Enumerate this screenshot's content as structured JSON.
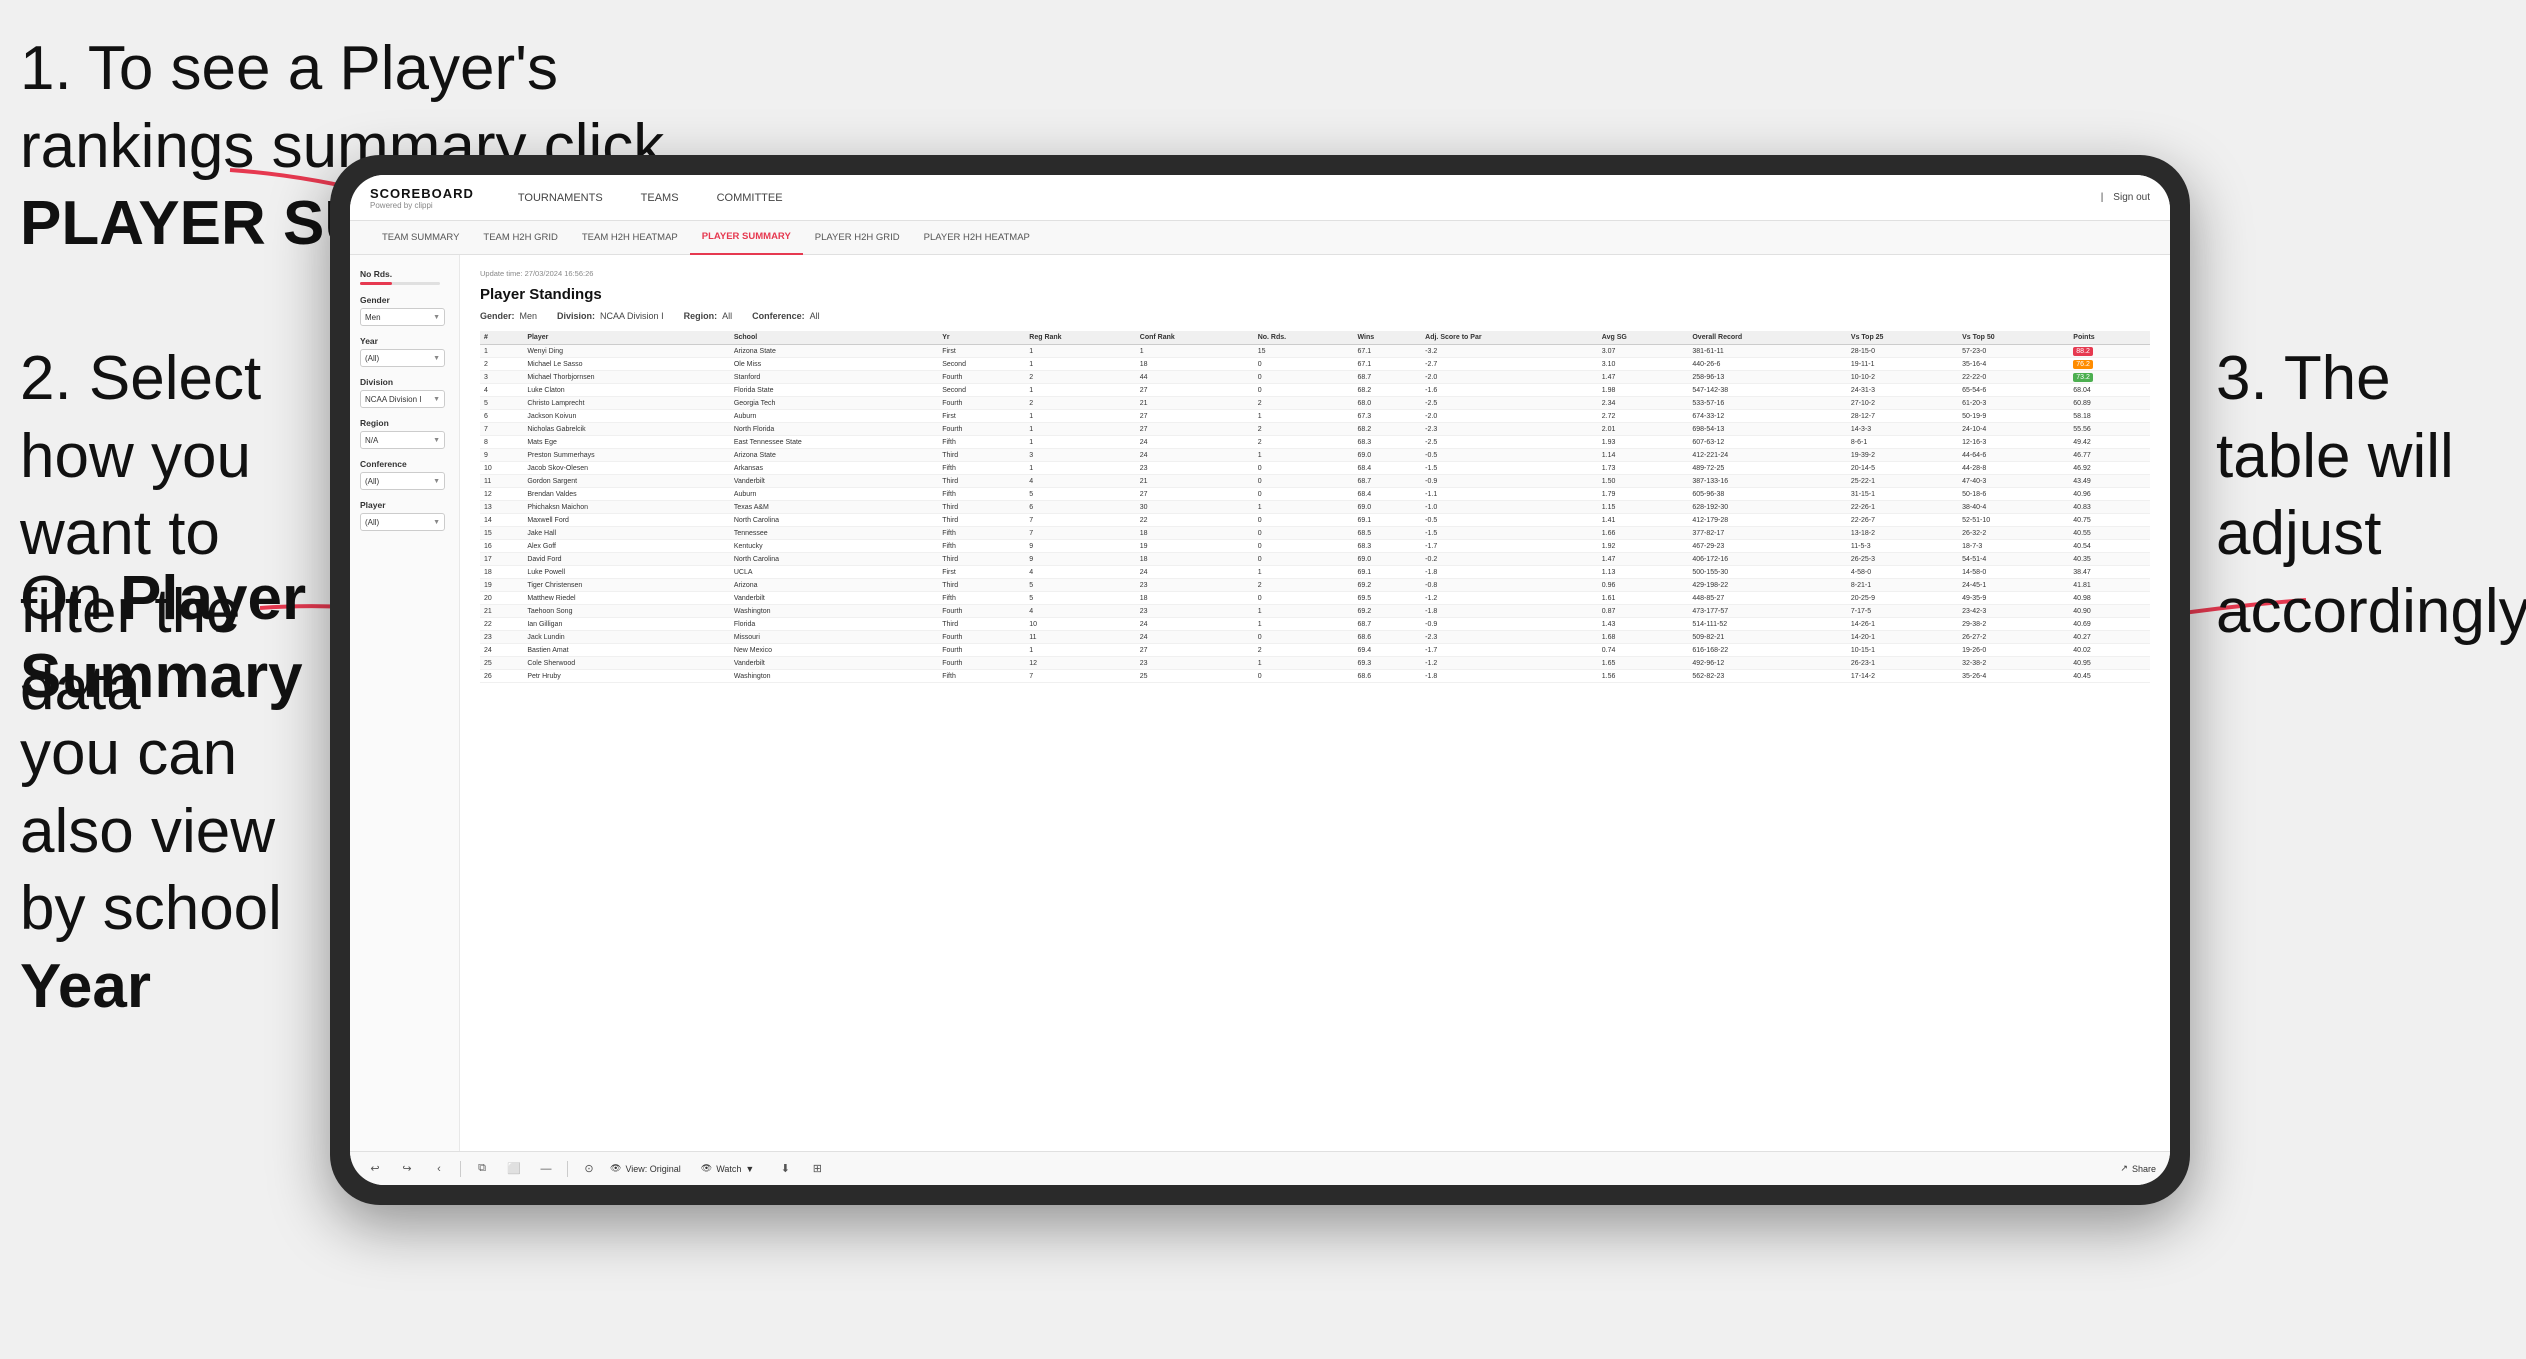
{
  "page": {
    "background": "#ffffff"
  },
  "instructions": {
    "step1": "1. To see a Player's rankings summary click ",
    "step1_bold": "PLAYER SUMMARY",
    "step2_line1": "2. Select how you want to",
    "step2_line2": "filter the data",
    "step3_line1": "3. The table will",
    "step3_line2": "adjust accordingly",
    "step4_line1": "On ",
    "step4_bold1": "Player",
    "step4_line2": "Summary",
    "step4_suffix": " you can also view by school ",
    "step4_bold2": "Year"
  },
  "nav": {
    "logo": "SCOREBOARD",
    "logo_sub": "Powered by clippi",
    "items": [
      "TOURNAMENTS",
      "TEAMS",
      "COMMITTEE"
    ],
    "right": [
      "Sign out"
    ]
  },
  "subnav": {
    "items": [
      "TEAM SUMMARY",
      "TEAM H2H GRID",
      "TEAM H2H HEATMAP",
      "PLAYER SUMMARY",
      "PLAYER H2H GRID",
      "PLAYER H2H HEATMAP"
    ],
    "active": "PLAYER SUMMARY"
  },
  "sidebar": {
    "no_rds_label": "No Rds.",
    "gender_label": "Gender",
    "gender_value": "Men",
    "year_label": "Year",
    "year_value": "(All)",
    "division_label": "Division",
    "division_value": "NCAA Division I",
    "region_label": "Region",
    "region_value": "N/A",
    "conference_label": "Conference",
    "conference_value": "(All)",
    "player_label": "Player",
    "player_value": "(All)"
  },
  "table": {
    "update_time": "Update time:\n27/03/2024 16:56:26",
    "title": "Player Standings",
    "gender": "Men",
    "division": "NCAA Division I",
    "region": "All",
    "conference": "All",
    "columns": [
      "#",
      "Player",
      "School",
      "Yr",
      "Reg Rank",
      "Conf Rank",
      "No. Rds.",
      "Wins",
      "Adj. Score to Par",
      "Avg SG",
      "Overall Record",
      "Vs Top 25",
      "Vs Top 50",
      "Points"
    ],
    "rows": [
      [
        "1",
        "Wenyi Ding",
        "Arizona State",
        "First",
        "1",
        "1",
        "15",
        "67.1",
        "-3.2",
        "3.07",
        "381-61-11",
        "28-15-0",
        "57-23-0",
        "88.2"
      ],
      [
        "2",
        "Michael Le Sasso",
        "Ole Miss",
        "Second",
        "1",
        "18",
        "0",
        "67.1",
        "-2.7",
        "3.10",
        "440-26-6",
        "19-11-1",
        "35-16-4",
        "76.2"
      ],
      [
        "3",
        "Michael Thorbjornsen",
        "Stanford",
        "Fourth",
        "2",
        "44",
        "0",
        "68.7",
        "-2.0",
        "1.47",
        "258-96-13",
        "10-10-2",
        "22-22-0",
        "73.2"
      ],
      [
        "4",
        "Luke Claton",
        "Florida State",
        "Second",
        "1",
        "27",
        "0",
        "68.2",
        "-1.6",
        "1.98",
        "547-142-38",
        "24-31-3",
        "65-54-6",
        "68.04"
      ],
      [
        "5",
        "Christo Lamprecht",
        "Georgia Tech",
        "Fourth",
        "2",
        "21",
        "2",
        "68.0",
        "-2.5",
        "2.34",
        "533-57-16",
        "27-10-2",
        "61-20-3",
        "60.89"
      ],
      [
        "6",
        "Jackson Koivun",
        "Auburn",
        "First",
        "1",
        "27",
        "1",
        "67.3",
        "-2.0",
        "2.72",
        "674-33-12",
        "28-12-7",
        "50-19-9",
        "58.18"
      ],
      [
        "7",
        "Nicholas Gabrelcik",
        "North Florida",
        "Fourth",
        "1",
        "27",
        "2",
        "68.2",
        "-2.3",
        "2.01",
        "698-54-13",
        "14-3-3",
        "24-10-4",
        "55.56"
      ],
      [
        "8",
        "Mats Ege",
        "East Tennessee State",
        "Fifth",
        "1",
        "24",
        "2",
        "68.3",
        "-2.5",
        "1.93",
        "607-63-12",
        "8-6-1",
        "12-16-3",
        "49.42"
      ],
      [
        "9",
        "Preston Summerhays",
        "Arizona State",
        "Third",
        "3",
        "24",
        "1",
        "69.0",
        "-0.5",
        "1.14",
        "412-221-24",
        "19-39-2",
        "44-64-6",
        "46.77"
      ],
      [
        "10",
        "Jacob Skov-Olesen",
        "Arkansas",
        "Fifth",
        "1",
        "23",
        "0",
        "68.4",
        "-1.5",
        "1.73",
        "489-72-25",
        "20-14-5",
        "44-28-8",
        "46.92"
      ],
      [
        "11",
        "Gordon Sargent",
        "Vanderbilt",
        "Third",
        "4",
        "21",
        "0",
        "68.7",
        "-0.9",
        "1.50",
        "387-133-16",
        "25-22-1",
        "47-40-3",
        "43.49"
      ],
      [
        "12",
        "Brendan Valdes",
        "Auburn",
        "Fifth",
        "5",
        "27",
        "0",
        "68.4",
        "-1.1",
        "1.79",
        "605-96-38",
        "31-15-1",
        "50-18-6",
        "40.96"
      ],
      [
        "13",
        "Phichaksn Maichon",
        "Texas A&M",
        "Third",
        "6",
        "30",
        "1",
        "69.0",
        "-1.0",
        "1.15",
        "628-192-30",
        "22-26-1",
        "38-40-4",
        "40.83"
      ],
      [
        "14",
        "Maxwell Ford",
        "North Carolina",
        "Third",
        "7",
        "22",
        "0",
        "69.1",
        "-0.5",
        "1.41",
        "412-179-28",
        "22-26-7",
        "52-51-10",
        "40.75"
      ],
      [
        "15",
        "Jake Hall",
        "Tennessee",
        "Fifth",
        "7",
        "18",
        "0",
        "68.5",
        "-1.5",
        "1.66",
        "377-82-17",
        "13-18-2",
        "26-32-2",
        "40.55"
      ],
      [
        "16",
        "Alex Goff",
        "Kentucky",
        "Fifth",
        "9",
        "19",
        "0",
        "68.3",
        "-1.7",
        "1.92",
        "467-29-23",
        "11-5-3",
        "18-7-3",
        "40.54"
      ],
      [
        "17",
        "David Ford",
        "North Carolina",
        "Third",
        "9",
        "18",
        "0",
        "69.0",
        "-0.2",
        "1.47",
        "406-172-16",
        "26-25-3",
        "54-51-4",
        "40.35"
      ],
      [
        "18",
        "Luke Powell",
        "UCLA",
        "First",
        "4",
        "24",
        "1",
        "69.1",
        "-1.8",
        "1.13",
        "500-155-30",
        "4-58-0",
        "14-58-0",
        "38.47"
      ],
      [
        "19",
        "Tiger Christensen",
        "Arizona",
        "Third",
        "5",
        "23",
        "2",
        "69.2",
        "-0.8",
        "0.96",
        "429-198-22",
        "8-21-1",
        "24-45-1",
        "41.81"
      ],
      [
        "20",
        "Matthew Riedel",
        "Vanderbilt",
        "Fifth",
        "5",
        "18",
        "0",
        "69.5",
        "-1.2",
        "1.61",
        "448-85-27",
        "20-25-9",
        "49-35-9",
        "40.98"
      ],
      [
        "21",
        "Taehoon Song",
        "Washington",
        "Fourth",
        "4",
        "23",
        "1",
        "69.2",
        "-1.8",
        "0.87",
        "473-177-57",
        "7-17-5",
        "23-42-3",
        "40.90"
      ],
      [
        "22",
        "Ian Gilligan",
        "Florida",
        "Third",
        "10",
        "24",
        "1",
        "68.7",
        "-0.9",
        "1.43",
        "514-111-52",
        "14-26-1",
        "29-38-2",
        "40.69"
      ],
      [
        "23",
        "Jack Lundin",
        "Missouri",
        "Fourth",
        "11",
        "24",
        "0",
        "68.6",
        "-2.3",
        "1.68",
        "509-82-21",
        "14-20-1",
        "26-27-2",
        "40.27"
      ],
      [
        "24",
        "Bastien Amat",
        "New Mexico",
        "Fourth",
        "1",
        "27",
        "2",
        "69.4",
        "-1.7",
        "0.74",
        "616-168-22",
        "10-15-1",
        "19-26-0",
        "40.02"
      ],
      [
        "25",
        "Cole Sherwood",
        "Vanderbilt",
        "Fourth",
        "12",
        "23",
        "1",
        "69.3",
        "-1.2",
        "1.65",
        "492-96-12",
        "26-23-1",
        "32-38-2",
        "40.95"
      ],
      [
        "26",
        "Petr Hruby",
        "Washington",
        "Fifth",
        "7",
        "25",
        "0",
        "68.6",
        "-1.8",
        "1.56",
        "562-82-23",
        "17-14-2",
        "35-26-4",
        "40.45"
      ]
    ]
  },
  "toolbar": {
    "view_label": "View: Original",
    "watch_label": "Watch",
    "share_label": "Share"
  }
}
